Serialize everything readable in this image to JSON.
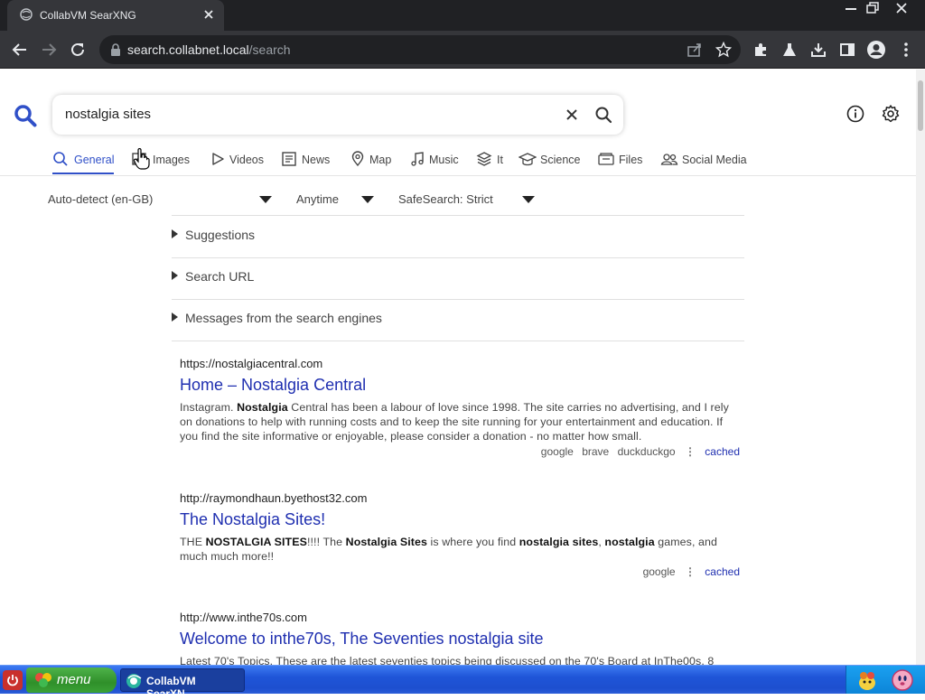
{
  "browser": {
    "tab_title": "CollabVM SearXNG",
    "url_host": "search.collabnet.local",
    "url_path": "/search"
  },
  "search": {
    "query": "nostalgia sites"
  },
  "categories": [
    {
      "label": "General",
      "icon": "search-icon",
      "active": true
    },
    {
      "label": "Images",
      "icon": "image-icon",
      "active": false
    },
    {
      "label": "Videos",
      "icon": "play-icon",
      "active": false
    },
    {
      "label": "News",
      "icon": "newspaper-icon",
      "active": false
    },
    {
      "label": "Map",
      "icon": "map-pin-icon",
      "active": false
    },
    {
      "label": "Music",
      "icon": "music-note-icon",
      "active": false
    },
    {
      "label": "It",
      "icon": "layers-icon",
      "active": false
    },
    {
      "label": "Science",
      "icon": "school-icon",
      "active": false
    },
    {
      "label": "Files",
      "icon": "files-icon",
      "active": false
    },
    {
      "label": "Social Media",
      "icon": "people-icon",
      "active": false
    }
  ],
  "filters": {
    "language": "Auto-detect (en-GB)",
    "time_range": "Anytime",
    "safesearch": "SafeSearch: Strict"
  },
  "panels": {
    "suggestions": "Suggestions",
    "search_url": "Search URL",
    "engine_messages": "Messages from the search engines"
  },
  "results": [
    {
      "url": "https://nostalgiacentral.com",
      "title": "Home – Nostalgia Central",
      "engines": [
        "google",
        "brave",
        "duckduckgo"
      ],
      "cached": "cached"
    },
    {
      "url": "http://raymondhaun.byethost32.com",
      "title": "The Nostalgia Sites!",
      "engines": [
        "google"
      ],
      "cached": "cached"
    },
    {
      "url": "http://www.inthe70s.com",
      "title": "Welcome to inthe70s, The Seventies nostalgia site",
      "content_partial": "Latest 70's Topics. These are the latest seventies topics being discussed on the 70's Board at InThe00s. 8"
    }
  ],
  "result_snippets": {
    "r1": [
      "Instagram. ",
      "Nostalgia",
      " Central has been a labour of love since 1998. The site carries no advertising, and I rely on donations to help with running costs and to keep the site running for your entertainment and education. If you find the site informative or enjoyable, please consider a donation - no matter how small."
    ],
    "r2": [
      "THE ",
      "NOSTALGIA SITES",
      "!!!! The ",
      "Nostalgia Sites",
      " is where you find ",
      "nostalgia sites",
      ", ",
      "nostalgia",
      " games, and much much more!!"
    ]
  },
  "taskbar": {
    "start_label": "menu",
    "task_label": "CollabVM SearXN..."
  },
  "colors": {
    "accent": "#3050c8",
    "link": "#1f2fb0",
    "chrome_dark": "#202124",
    "taskbar_blue": "#1f55d8",
    "start_green": "#2f8f2a"
  }
}
